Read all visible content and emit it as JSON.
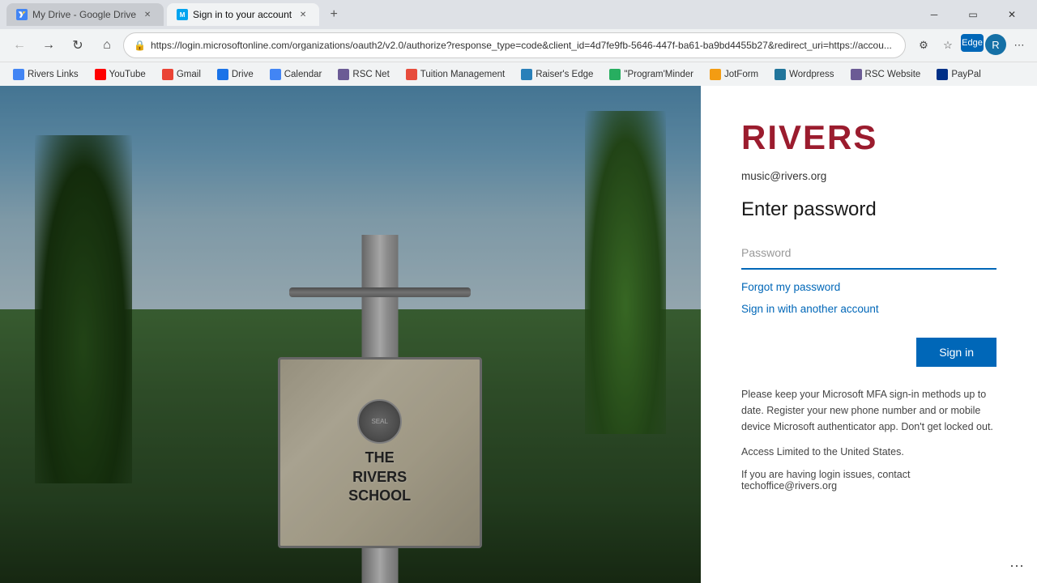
{
  "browser": {
    "tabs": [
      {
        "id": "tab-googledrive",
        "label": "My Drive - Google Drive",
        "favicon_color": "#4285f4",
        "active": false
      },
      {
        "id": "tab-signin",
        "label": "Sign in to your account",
        "favicon_color": "#00a4ef",
        "active": true
      }
    ],
    "new_tab_label": "+",
    "address": "https://login.microsoftonline.com/organizations/oauth2/v2.0/authorize?response_type=code&client_id=4d7fe9fb-5646-447f-ba61-ba9bd4455b27&redirect_uri=https://accou...",
    "window_controls": {
      "minimize": "─",
      "maximize": "□",
      "close": "✕"
    }
  },
  "bookmarks": [
    {
      "label": "Rivers Links",
      "color": "#4285f4"
    },
    {
      "label": "YouTube",
      "color": "#ff0000"
    },
    {
      "label": "Gmail",
      "color": "#ea4335"
    },
    {
      "label": "Drive",
      "color": "#1a73e8"
    },
    {
      "label": "Calendar",
      "color": "#4285f4"
    },
    {
      "label": "RSC Net",
      "color": "#6b5b95"
    },
    {
      "label": "Tuition Management",
      "color": "#e74c3c"
    },
    {
      "label": "Raiser's Edge",
      "color": "#2980b9"
    },
    {
      "label": "\"Program'Minder",
      "color": "#27ae60"
    },
    {
      "label": "JotForm",
      "color": "#f39c12"
    },
    {
      "label": "Wordpress",
      "color": "#21759b"
    },
    {
      "label": "RSC Website",
      "color": "#6b5b95"
    },
    {
      "label": "PayPal",
      "color": "#003087"
    }
  ],
  "login": {
    "brand": "RIVERS",
    "email": "music@rivers.org",
    "title": "Enter password",
    "password_placeholder": "Password",
    "forgot_link": "Forgot my password",
    "other_account_link": "Sign in with another account",
    "sign_in_button": "Sign in",
    "info_paragraph": "Please keep your Microsoft MFA sign-in methods up to date. Register your new phone number and or mobile device Microsoft authenticator app. Don't get locked out.",
    "access_text": "Access Limited to the United States.",
    "contact_text": "If you are having login issues, contact techoffice@rivers.org"
  },
  "sign_text": {
    "line1": "THE",
    "line2": "RIVERS",
    "line3": "SCHOOL"
  }
}
